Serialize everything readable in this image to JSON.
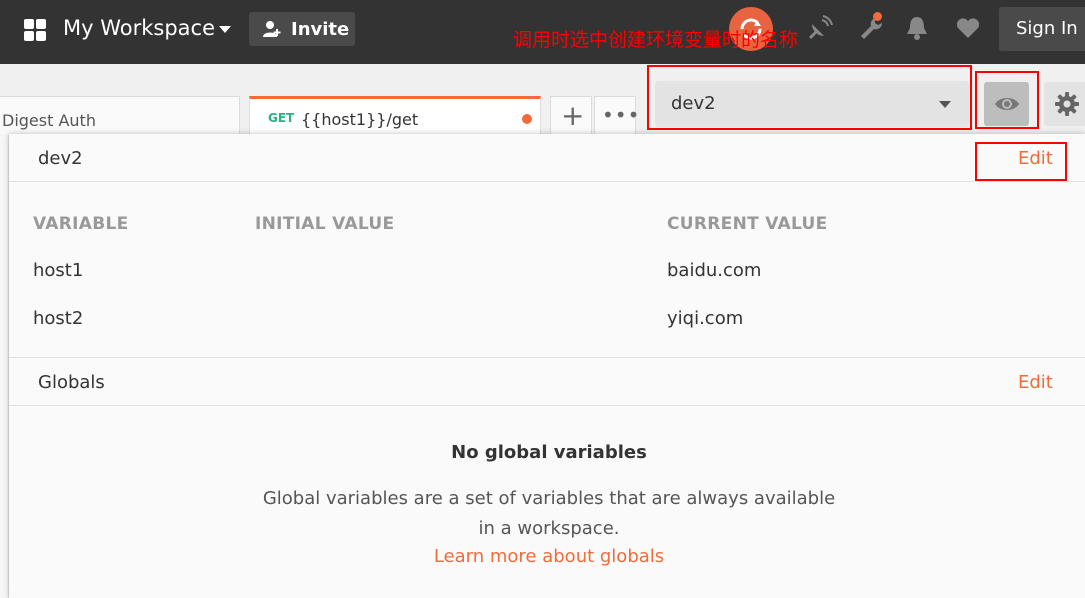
{
  "topbar": {
    "workspace_title": "My Workspace",
    "invite_label": "Invite",
    "signin_label": "Sign In",
    "icons": [
      "grid-icon",
      "chevron-down-icon",
      "add-person-icon",
      "sync-icon",
      "satellite-icon",
      "wrench-icon",
      "bell-icon",
      "heart-icon"
    ]
  },
  "annotation": "调用时选中创建环境变量时的名称",
  "tabs": {
    "digest_label": "Digest Auth",
    "active_method": "GET",
    "active_url": "{{host1}}/get",
    "add_label": "+",
    "more_label": "•••"
  },
  "environment": {
    "selected": "dev2"
  },
  "panel": {
    "env_name": "dev2",
    "edit_label": "Edit",
    "columns": [
      "VARIABLE",
      "INITIAL VALUE",
      "CURRENT VALUE"
    ],
    "variables": [
      {
        "name": "host1",
        "initial": "",
        "current": "baidu.com"
      },
      {
        "name": "host2",
        "initial": "",
        "current": "yiqi.com"
      }
    ],
    "globals_label": "Globals",
    "globals_edit_label": "Edit",
    "empty_title": "No global variables",
    "empty_desc": "Global variables are a set of variables that are always available in a workspace.",
    "learn_more": "Learn more about globals"
  },
  "colors": {
    "topbar": "#333333",
    "accent": "#f26b3a",
    "get_method": "#26b47f",
    "annotation": "#ff0000"
  }
}
